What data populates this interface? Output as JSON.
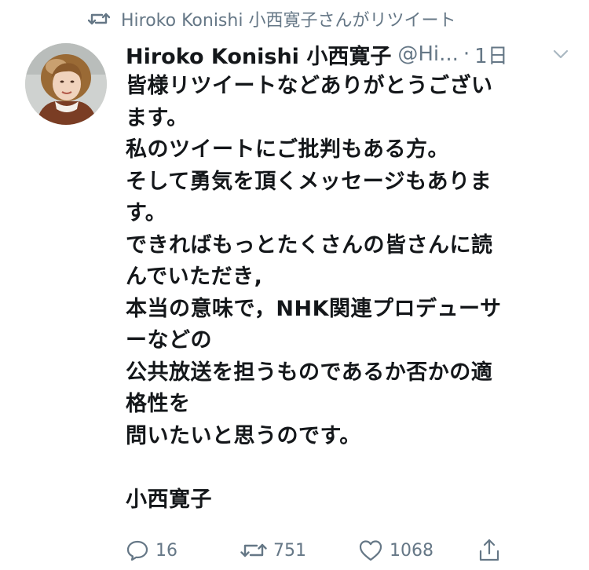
{
  "retweet_context": {
    "text": "Hiroko Konishi 小西寛子さんがリツイート",
    "icon": "retweet-icon"
  },
  "tweet": {
    "author_name": "Hiroko Konishi 小西寛子",
    "handle": "@Hi...",
    "separator": "·",
    "time": "1日",
    "menu_icon": "chevron-down-icon",
    "lines": [
      "皆様リツイートなどありがとうござい",
      "ます。",
      "私のツイートにご批判もある方。",
      "そして勇気を頂くメッセージもありま",
      "す。",
      "できればもっとたくさんの皆さんに読",
      "んでいただき,",
      "本当の意味で，NHK関連プロデューサ",
      "ーなどの",
      "公共放送を担うものであるか否かの適",
      "格性を",
      "問いたいと思うのです。",
      "",
      "小西寛子"
    ]
  },
  "actions": {
    "reply_count": "16",
    "retweet_count": "751",
    "like_count": "1068",
    "reply_icon": "reply-icon",
    "retweet_icon": "retweet-icon",
    "like_icon": "heart-icon",
    "share_icon": "share-icon"
  },
  "colors": {
    "text": "#14171a",
    "muted": "#657786"
  }
}
